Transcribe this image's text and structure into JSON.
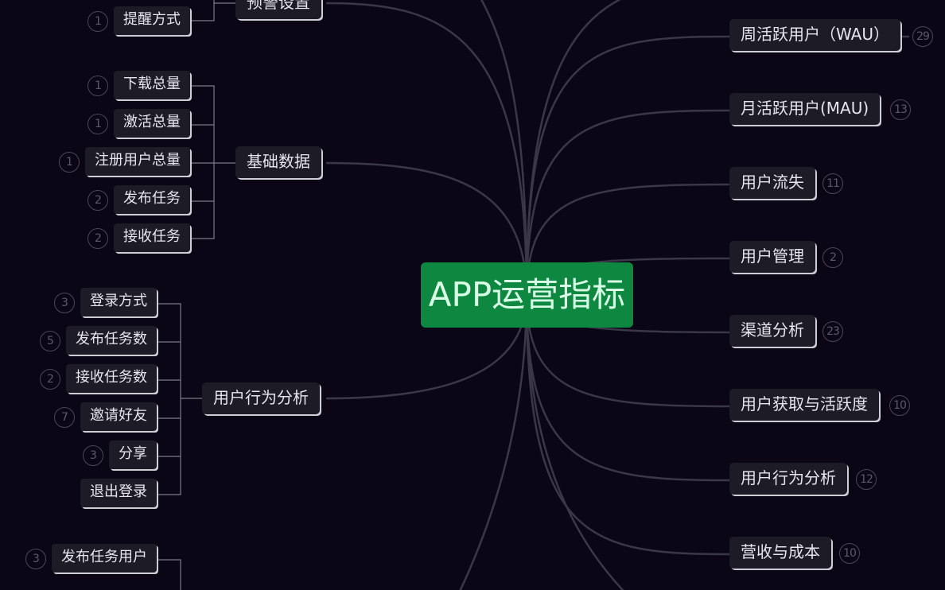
{
  "root": {
    "label": "APP运营指标"
  },
  "left_branches": [
    {
      "label": "预警设置",
      "children": [
        {
          "label": "提醒方式",
          "count": "1"
        }
      ]
    },
    {
      "label": "基础数据",
      "children": [
        {
          "label": "下载总量",
          "count": "1"
        },
        {
          "label": "激活总量",
          "count": "1"
        },
        {
          "label": "注册用户总量",
          "count": "1"
        },
        {
          "label": "发布任务",
          "count": "2"
        },
        {
          "label": "接收任务",
          "count": "2"
        }
      ]
    },
    {
      "label": "用户行为分析",
      "children": [
        {
          "label": "登录方式",
          "count": "3"
        },
        {
          "label": "发布任务数",
          "count": "5"
        },
        {
          "label": "接收任务数",
          "count": "2"
        },
        {
          "label": "邀请好友",
          "count": "7"
        },
        {
          "label": "分享",
          "count": "3"
        },
        {
          "label": "退出登录"
        }
      ]
    },
    {
      "label": "",
      "children": [
        {
          "label": "发布任务用户",
          "count": "3"
        }
      ]
    }
  ],
  "right_branches": [
    {
      "label": "周活跃用户（WAU）",
      "count": "29"
    },
    {
      "label": "月活跃用户(MAU)",
      "count": "13"
    },
    {
      "label": "用户流失",
      "count": "11"
    },
    {
      "label": "用户管理",
      "count": "2"
    },
    {
      "label": "渠道分析",
      "count": "23"
    },
    {
      "label": "用户获取与活跃度",
      "count": "10"
    },
    {
      "label": "用户行为分析",
      "count": "12"
    },
    {
      "label": "营收与成本",
      "count": "10"
    }
  ]
}
